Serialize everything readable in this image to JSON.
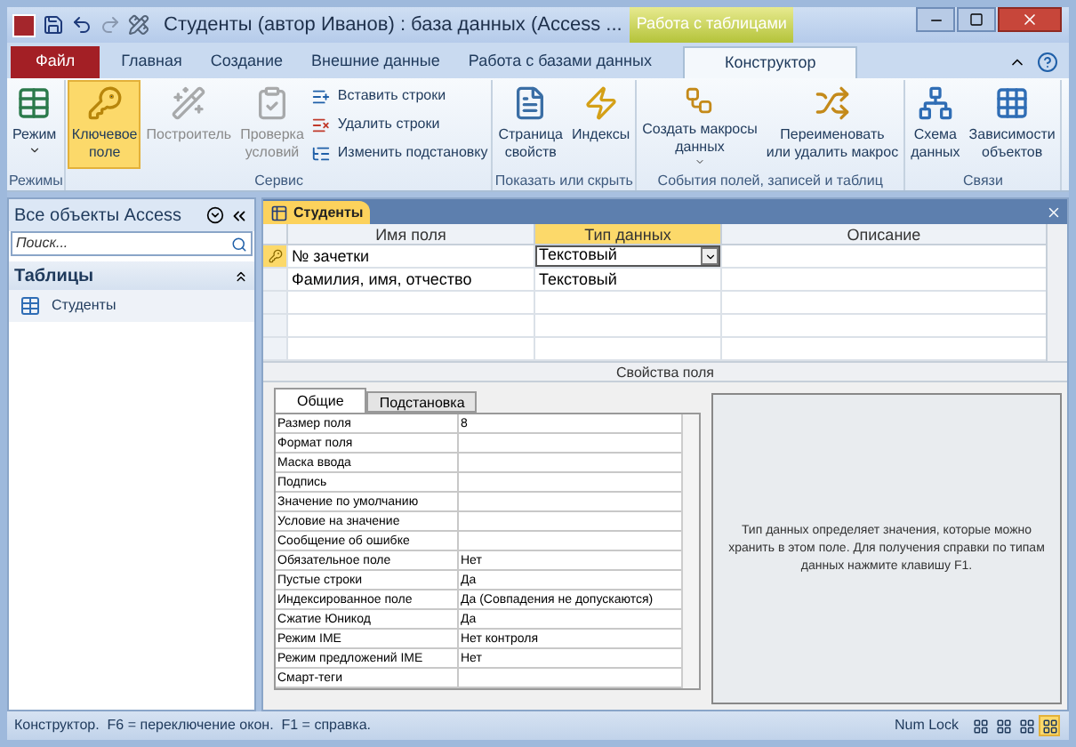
{
  "window": {
    "title": "Студенты (автор Иванов) : база данных (Access ...",
    "context_tab": "Работа с таблицами"
  },
  "file_tab": "Файл",
  "tabs": [
    {
      "label": "Главная",
      "selected": false
    },
    {
      "label": "Создание",
      "selected": false
    },
    {
      "label": "Внешние данные",
      "selected": false
    },
    {
      "label": "Работа с базами данных",
      "selected": false
    },
    {
      "label": "Конструктор",
      "selected": true
    }
  ],
  "ribbon": [
    {
      "label": "Режимы",
      "buttons": [
        {
          "kind": "large",
          "label": "Режим",
          "dropdown": true,
          "selected": false,
          "disabled": false
        }
      ]
    },
    {
      "label": "Сервис",
      "buttons": [
        {
          "kind": "large",
          "label": "Ключевое\nполе",
          "selected": true,
          "disabled": false
        },
        {
          "kind": "large",
          "label": "Построитель",
          "selected": false,
          "disabled": true
        },
        {
          "kind": "large",
          "label": "Проверка\nусловий",
          "selected": false,
          "disabled": true
        },
        {
          "kind": "small",
          "label": "Вставить строки",
          "selected": false,
          "disabled": false
        },
        {
          "kind": "small",
          "label": "Удалить строки",
          "selected": false,
          "disabled": false
        },
        {
          "kind": "small",
          "label": "Изменить подстановку",
          "selected": false,
          "disabled": false
        }
      ]
    },
    {
      "label": "Показать или скрыть",
      "buttons": [
        {
          "kind": "large",
          "label": "Страница\nсвойств",
          "selected": false,
          "disabled": false
        },
        {
          "kind": "large",
          "label": "Индексы",
          "selected": false,
          "disabled": false
        }
      ]
    },
    {
      "label": "События полей, записей и таблиц",
      "buttons": [
        {
          "kind": "large",
          "label": "Создать макросы\nданных",
          "dropdown": true,
          "selected": false,
          "disabled": false
        },
        {
          "kind": "large",
          "label": "Переименовать\nили удалить макрос",
          "selected": false,
          "disabled": false
        }
      ]
    },
    {
      "label": "Связи",
      "buttons": [
        {
          "kind": "large",
          "label": "Схема\nданных",
          "selected": false,
          "disabled": false
        },
        {
          "kind": "large",
          "label": "Зависимости\nобъектов",
          "selected": false,
          "disabled": false
        }
      ]
    }
  ],
  "nav_pane": {
    "title": "Все объекты Access",
    "search": {
      "placeholder": "Поиск..."
    },
    "groups": [
      {
        "label": "Таблицы",
        "expanded": true,
        "items": [
          {
            "label": "Студенты",
            "selected": false
          }
        ]
      }
    ]
  },
  "document": {
    "tab": "Студенты",
    "columns": [
      "Имя поля",
      "Тип данных",
      "Описание"
    ],
    "rows": [
      {
        "name": "№ зачетки",
        "type": "Текстовый",
        "primary_key": true,
        "selected": true
      },
      {
        "name": "Фамилия, имя, отчество",
        "type": "Текстовый",
        "primary_key": false,
        "selected": false
      }
    ],
    "properties_title": "Свойства поля",
    "property_tabs": [
      {
        "label": "Общие",
        "selected": true
      },
      {
        "label": "Подстановка",
        "selected": false
      }
    ],
    "properties": [
      {
        "label": "Размер поля",
        "value": "8"
      },
      {
        "label": "Формат поля"
      },
      {
        "label": "Маска ввода"
      },
      {
        "label": "Подпись"
      },
      {
        "label": "Значение по умолчанию"
      },
      {
        "label": "Условие на значение"
      },
      {
        "label": "Сообщение об ошибке"
      },
      {
        "label": "Обязательное поле",
        "value": "Нет"
      },
      {
        "label": "Пустые строки",
        "value": "Да"
      },
      {
        "label": "Индексированное поле",
        "value": "Да (Совпадения не допускаются)"
      },
      {
        "label": "Сжатие Юникод",
        "value": "Да"
      },
      {
        "label": "Режим IME",
        "value": "Нет контроля"
      },
      {
        "label": "Режим предложений IME",
        "value": "Нет"
      },
      {
        "label": "Смарт-теги"
      }
    ],
    "help": "Тип данных определяет значения, которые можно хранить в этом поле. Для получения справки по типам данных нажмите клавишу F1."
  },
  "status_bar": {
    "text": "Конструктор.  F6 = переключение окон.  F1 = справка.",
    "num_lock": "Num Lock",
    "views": [
      {
        "selected": false
      },
      {
        "selected": false
      },
      {
        "selected": false
      },
      {
        "selected": true
      }
    ]
  }
}
